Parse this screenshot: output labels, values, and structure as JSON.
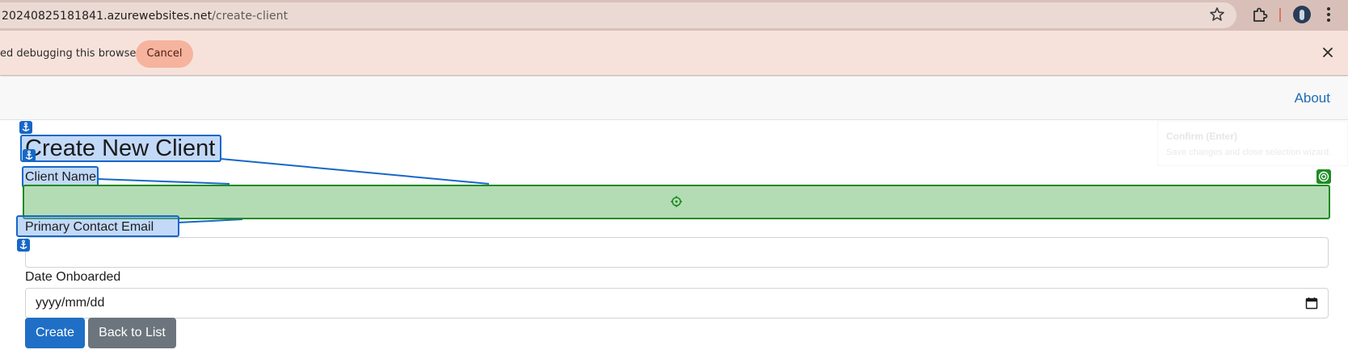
{
  "browser": {
    "url_host": "20240825181841.azurewebsites.net",
    "url_path": "/create-client"
  },
  "info_bar": {
    "message": "ed debugging this browser",
    "cancel_label": "Cancel"
  },
  "navbar": {
    "about_label": "About"
  },
  "ghost_tooltip": {
    "title": "Confirm (Enter)",
    "subtitle": "Save changes and close selection wizard."
  },
  "form": {
    "title": "Create New Client",
    "client_name_label": "Client Name",
    "client_name_value": "",
    "email_label": "Primary Contact Email",
    "email_value": "",
    "date_label": "Date Onboarded",
    "date_placeholder": "yyyy/mm/dd",
    "create_label": "Create",
    "back_label": "Back to List"
  },
  "colors": {
    "highlight_blue": "#1667c7",
    "highlight_green": "#1f8b24",
    "primary_button": "#1f6fc6",
    "secondary_button": "#6c757d",
    "link": "#1e6cb6"
  }
}
